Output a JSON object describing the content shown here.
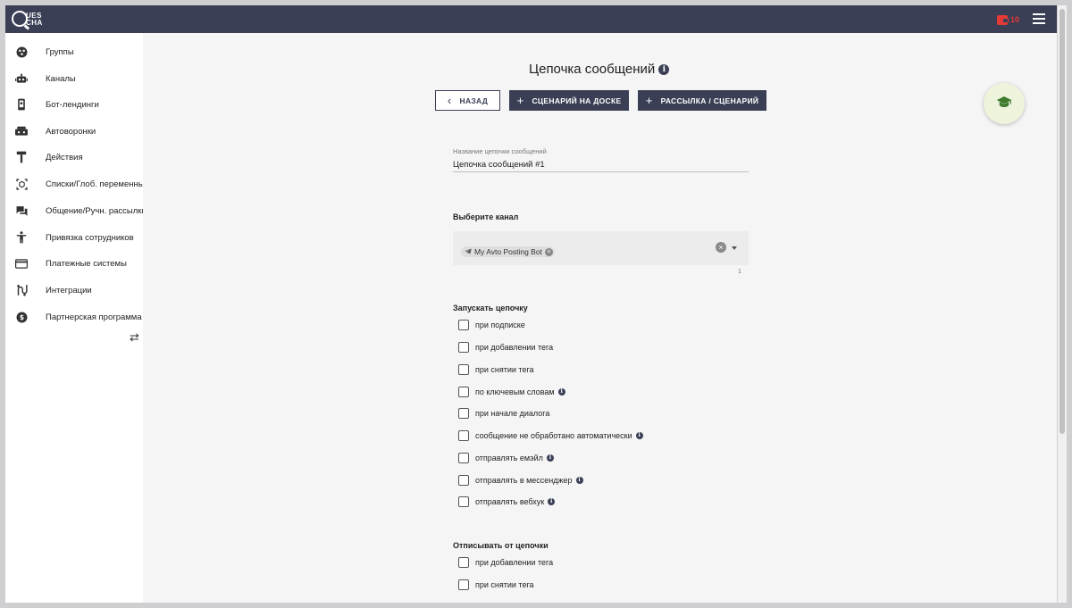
{
  "header": {
    "logo_top": "UES",
    "logo_bottom": "CHA",
    "balance": "10",
    "icons": {
      "wallet": "wallet-icon",
      "menu": "menu-icon"
    },
    "colors": {
      "bar": "#3a3f55",
      "balance": "#e53935"
    }
  },
  "sidebar": {
    "items": [
      {
        "label": "Группы",
        "icon": "groups-icon"
      },
      {
        "label": "Каналы",
        "icon": "robot-icon"
      },
      {
        "label": "Бот-лендинги",
        "icon": "phone-icon"
      },
      {
        "label": "Автоворонки",
        "icon": "funnel-icon"
      },
      {
        "label": "Действия",
        "icon": "hammer-icon"
      },
      {
        "label": "Списки/Глоб. переменные",
        "icon": "variables-icon"
      },
      {
        "label": "Общение/Ручн. рассылки",
        "icon": "chat-icon"
      },
      {
        "label": "Привязка сотрудников",
        "icon": "person-icon"
      },
      {
        "label": "Платежные системы",
        "icon": "card-icon"
      },
      {
        "label": "Интеграции",
        "icon": "integration-icon"
      },
      {
        "label": "Партнерская программа",
        "icon": "dollar-icon"
      }
    ],
    "collapse_icon": "⇄"
  },
  "main": {
    "title": "Цепочка сообщений",
    "buttons": {
      "back": "НАЗАД",
      "board": "СЦЕНАРИЙ НА ДОСКЕ",
      "mailing": "РАССЫЛКА / СЦЕНАРИЙ"
    },
    "name_field": {
      "label": "Название цепочки сообщений",
      "value": "Цепочка сообщений #1"
    },
    "channel": {
      "title": "Выберите канал",
      "selected": "My Avto Posting Bot",
      "count": "1"
    },
    "start": {
      "title": "Запускать цепочку",
      "options": [
        {
          "label": "при подписке",
          "info": false,
          "checked": false
        },
        {
          "label": "при добавлении тега",
          "info": false,
          "checked": false
        },
        {
          "label": "при снятии тега",
          "info": false,
          "checked": false
        },
        {
          "label": "по ключевым словам",
          "info": true,
          "checked": false
        },
        {
          "label": "при начале диалога",
          "info": false,
          "checked": false
        },
        {
          "label": "сообщение не обработано автоматически",
          "info": true,
          "checked": false
        },
        {
          "label": "отправлять емэйл",
          "info": true,
          "checked": false
        },
        {
          "label": "отправлять в мессенджер",
          "info": true,
          "checked": false
        },
        {
          "label": "отправлять вебхук",
          "info": true,
          "checked": false
        }
      ]
    },
    "unsubscribe": {
      "title": "Отписывать от цепочки",
      "options": [
        {
          "label": "при добавлении тега",
          "checked": false
        },
        {
          "label": "при снятии тега",
          "checked": false
        }
      ]
    }
  }
}
